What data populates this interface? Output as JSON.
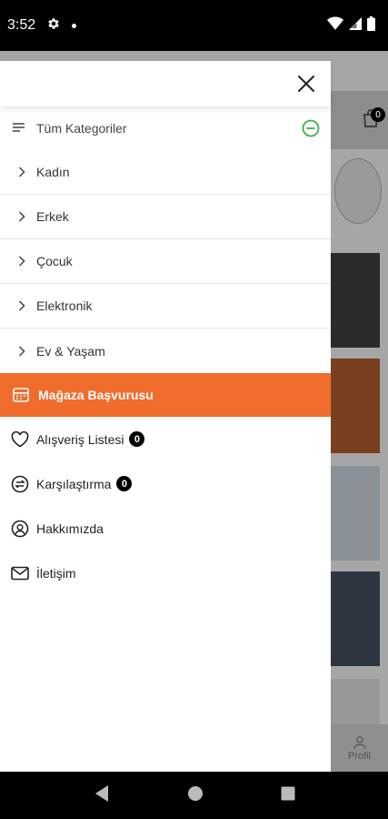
{
  "status_bar": {
    "time": "3:52"
  },
  "background": {
    "cart_count": "0",
    "bottom_nav_label": "Profil"
  },
  "drawer": {
    "all_categories": "Tüm Kategoriler",
    "categories": [
      "Kadın",
      "Erkek",
      "Çocuk",
      "Elektronik",
      "Ev & Yaşam"
    ],
    "store_application": "Mağaza Başvurusu",
    "wishlist": {
      "label": "Alışveriş Listesi",
      "count": "0"
    },
    "compare": {
      "label": "Karşılaştırma",
      "count": "0"
    },
    "about": "Hakkımızda",
    "contact": "İletişim"
  },
  "colors": {
    "accent": "#f06c2d",
    "minus_icon": "#3cb043"
  }
}
